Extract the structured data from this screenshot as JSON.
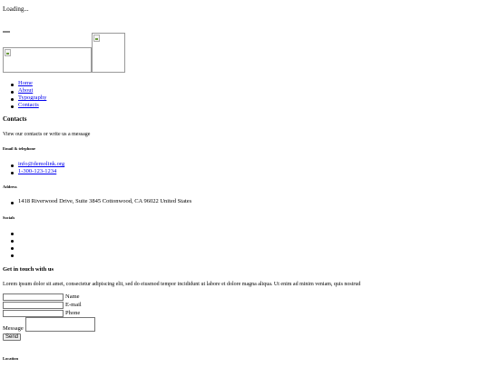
{
  "preloader": {
    "text": "Loading..."
  },
  "nav": {
    "items": [
      {
        "label": "Home"
      },
      {
        "label": "About"
      },
      {
        "label": "Typography"
      },
      {
        "label": "Contacts"
      }
    ]
  },
  "page": {
    "title": "Contacts",
    "subtitle": "View our contacts or write us a message"
  },
  "contacts": {
    "email_phone_heading": "Email & telephone",
    "email": "info@demolink.org",
    "phone": "1-300-123-1234",
    "address_heading": "Address",
    "address": "1418 Riverwood Drive, Suite 3845 Cottonwood, CA 96022 United States",
    "socials_heading": "Socials"
  },
  "form": {
    "heading": "Get in touch with us",
    "intro": "Lorem ipsum dolor sit amet, consectetur adipiscing elit, sed do eiusmod tempor incididunt ut labore et dolore magna aliqua. Ut enim ad minim veniam, quis nostrud",
    "name_label": "Name",
    "email_label": "E-mail",
    "phone_label": "Phone",
    "message_label": "Message",
    "send_label": "Send"
  },
  "location": {
    "heading": "Location"
  }
}
